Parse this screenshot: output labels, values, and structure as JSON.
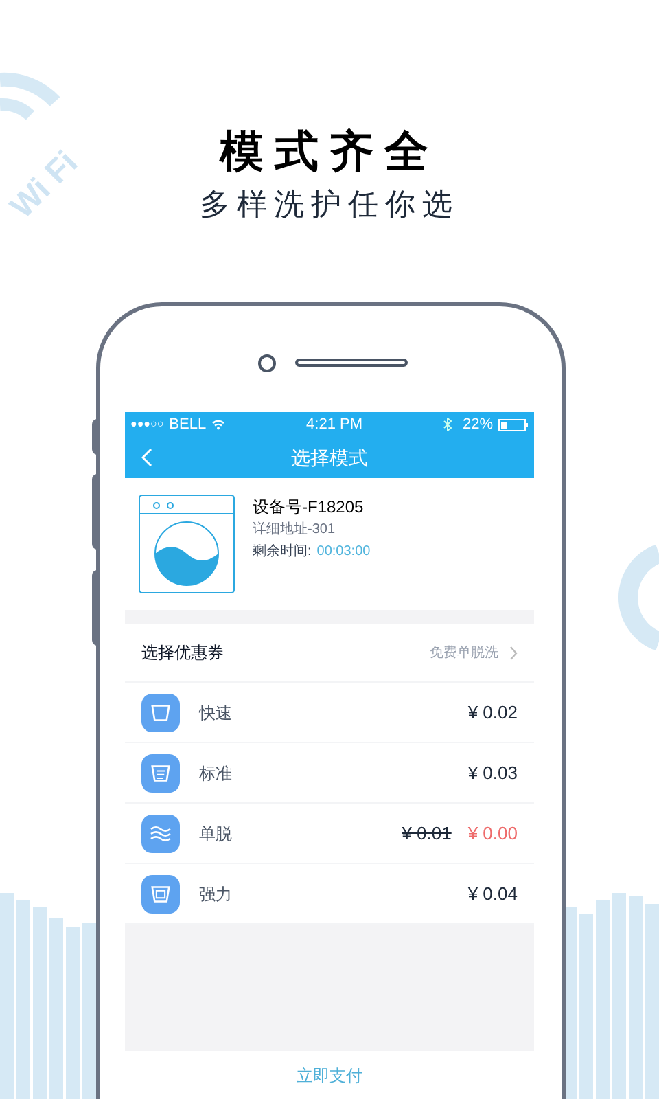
{
  "decoration": {
    "logo_text": "Wi Fi"
  },
  "headline": "模式齐全",
  "subheadline": "多样洗护任你选",
  "status_bar": {
    "signal": "●●●○○",
    "carrier": "BELL",
    "time": "4:21 PM",
    "battery": "22%"
  },
  "nav": {
    "title": "选择模式"
  },
  "device": {
    "number": "设备号-F18205",
    "address": "详细地址-301",
    "remaining_label": "剩余时间:",
    "remaining_time": "00:03:00"
  },
  "coupon": {
    "label": "选择优惠券",
    "value": "免费单脱洗"
  },
  "modes": [
    {
      "kind": "basin",
      "name": "快速",
      "price": "¥ 0.02",
      "discounted": false
    },
    {
      "kind": "lines",
      "name": "标准",
      "price": "¥ 0.03",
      "discounted": false
    },
    {
      "kind": "waves",
      "name": "单脱",
      "original_price": "¥ 0.01",
      "price": "¥ 0.00",
      "discounted": true
    },
    {
      "kind": "box",
      "name": "强力",
      "price": "¥ 0.04",
      "discounted": false
    }
  ],
  "pay_button": "立即支付"
}
